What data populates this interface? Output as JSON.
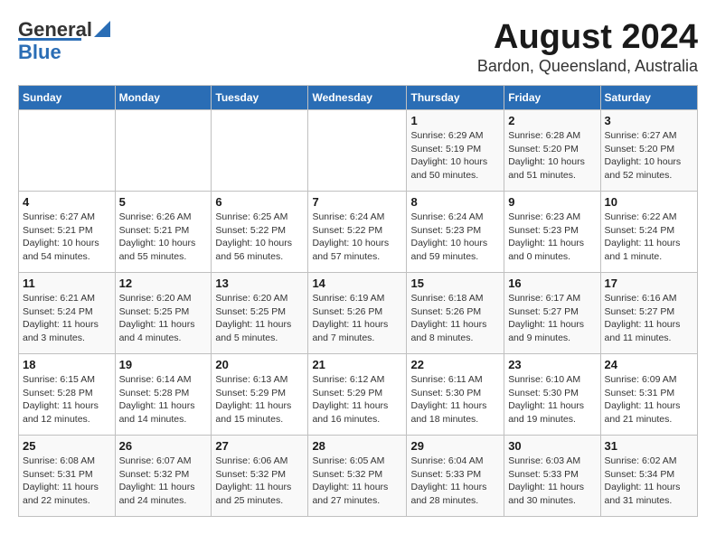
{
  "header": {
    "logo_general": "General",
    "logo_blue": "Blue",
    "title": "August 2024",
    "subtitle": "Bardon, Queensland, Australia"
  },
  "calendar": {
    "days_of_week": [
      "Sunday",
      "Monday",
      "Tuesday",
      "Wednesday",
      "Thursday",
      "Friday",
      "Saturday"
    ],
    "weeks": [
      [
        {
          "day": "",
          "info": ""
        },
        {
          "day": "",
          "info": ""
        },
        {
          "day": "",
          "info": ""
        },
        {
          "day": "",
          "info": ""
        },
        {
          "day": "1",
          "info": "Sunrise: 6:29 AM\nSunset: 5:19 PM\nDaylight: 10 hours\nand 50 minutes."
        },
        {
          "day": "2",
          "info": "Sunrise: 6:28 AM\nSunset: 5:20 PM\nDaylight: 10 hours\nand 51 minutes."
        },
        {
          "day": "3",
          "info": "Sunrise: 6:27 AM\nSunset: 5:20 PM\nDaylight: 10 hours\nand 52 minutes."
        }
      ],
      [
        {
          "day": "4",
          "info": "Sunrise: 6:27 AM\nSunset: 5:21 PM\nDaylight: 10 hours\nand 54 minutes."
        },
        {
          "day": "5",
          "info": "Sunrise: 6:26 AM\nSunset: 5:21 PM\nDaylight: 10 hours\nand 55 minutes."
        },
        {
          "day": "6",
          "info": "Sunrise: 6:25 AM\nSunset: 5:22 PM\nDaylight: 10 hours\nand 56 minutes."
        },
        {
          "day": "7",
          "info": "Sunrise: 6:24 AM\nSunset: 5:22 PM\nDaylight: 10 hours\nand 57 minutes."
        },
        {
          "day": "8",
          "info": "Sunrise: 6:24 AM\nSunset: 5:23 PM\nDaylight: 10 hours\nand 59 minutes."
        },
        {
          "day": "9",
          "info": "Sunrise: 6:23 AM\nSunset: 5:23 PM\nDaylight: 11 hours\nand 0 minutes."
        },
        {
          "day": "10",
          "info": "Sunrise: 6:22 AM\nSunset: 5:24 PM\nDaylight: 11 hours\nand 1 minute."
        }
      ],
      [
        {
          "day": "11",
          "info": "Sunrise: 6:21 AM\nSunset: 5:24 PM\nDaylight: 11 hours\nand 3 minutes."
        },
        {
          "day": "12",
          "info": "Sunrise: 6:20 AM\nSunset: 5:25 PM\nDaylight: 11 hours\nand 4 minutes."
        },
        {
          "day": "13",
          "info": "Sunrise: 6:20 AM\nSunset: 5:25 PM\nDaylight: 11 hours\nand 5 minutes."
        },
        {
          "day": "14",
          "info": "Sunrise: 6:19 AM\nSunset: 5:26 PM\nDaylight: 11 hours\nand 7 minutes."
        },
        {
          "day": "15",
          "info": "Sunrise: 6:18 AM\nSunset: 5:26 PM\nDaylight: 11 hours\nand 8 minutes."
        },
        {
          "day": "16",
          "info": "Sunrise: 6:17 AM\nSunset: 5:27 PM\nDaylight: 11 hours\nand 9 minutes."
        },
        {
          "day": "17",
          "info": "Sunrise: 6:16 AM\nSunset: 5:27 PM\nDaylight: 11 hours\nand 11 minutes."
        }
      ],
      [
        {
          "day": "18",
          "info": "Sunrise: 6:15 AM\nSunset: 5:28 PM\nDaylight: 11 hours\nand 12 minutes."
        },
        {
          "day": "19",
          "info": "Sunrise: 6:14 AM\nSunset: 5:28 PM\nDaylight: 11 hours\nand 14 minutes."
        },
        {
          "day": "20",
          "info": "Sunrise: 6:13 AM\nSunset: 5:29 PM\nDaylight: 11 hours\nand 15 minutes."
        },
        {
          "day": "21",
          "info": "Sunrise: 6:12 AM\nSunset: 5:29 PM\nDaylight: 11 hours\nand 16 minutes."
        },
        {
          "day": "22",
          "info": "Sunrise: 6:11 AM\nSunset: 5:30 PM\nDaylight: 11 hours\nand 18 minutes."
        },
        {
          "day": "23",
          "info": "Sunrise: 6:10 AM\nSunset: 5:30 PM\nDaylight: 11 hours\nand 19 minutes."
        },
        {
          "day": "24",
          "info": "Sunrise: 6:09 AM\nSunset: 5:31 PM\nDaylight: 11 hours\nand 21 minutes."
        }
      ],
      [
        {
          "day": "25",
          "info": "Sunrise: 6:08 AM\nSunset: 5:31 PM\nDaylight: 11 hours\nand 22 minutes."
        },
        {
          "day": "26",
          "info": "Sunrise: 6:07 AM\nSunset: 5:32 PM\nDaylight: 11 hours\nand 24 minutes."
        },
        {
          "day": "27",
          "info": "Sunrise: 6:06 AM\nSunset: 5:32 PM\nDaylight: 11 hours\nand 25 minutes."
        },
        {
          "day": "28",
          "info": "Sunrise: 6:05 AM\nSunset: 5:32 PM\nDaylight: 11 hours\nand 27 minutes."
        },
        {
          "day": "29",
          "info": "Sunrise: 6:04 AM\nSunset: 5:33 PM\nDaylight: 11 hours\nand 28 minutes."
        },
        {
          "day": "30",
          "info": "Sunrise: 6:03 AM\nSunset: 5:33 PM\nDaylight: 11 hours\nand 30 minutes."
        },
        {
          "day": "31",
          "info": "Sunrise: 6:02 AM\nSunset: 5:34 PM\nDaylight: 11 hours\nand 31 minutes."
        }
      ]
    ]
  }
}
